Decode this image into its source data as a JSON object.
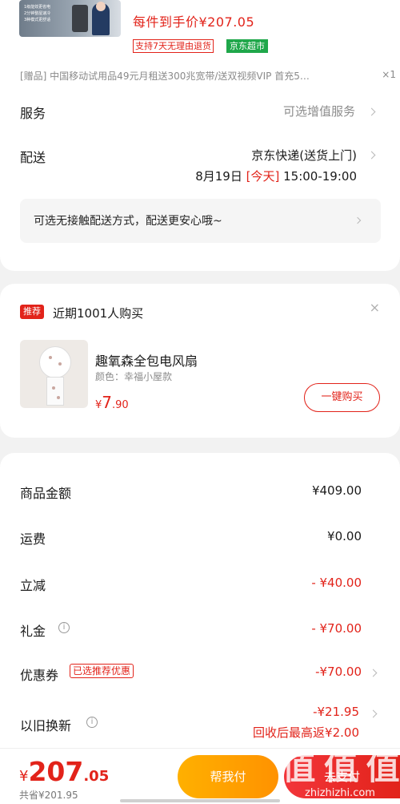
{
  "product": {
    "thumb_lines": [
      "1级能效更省电",
      "2分钟整屋速冷",
      "3种模式更舒适"
    ],
    "final_price_text": "每件到手价¥207.05",
    "return_badge": "支持7天无理由退货",
    "market_badge": "京东超市",
    "gift_text": "[赠品]   中国移动试用品49元月租送300兆宽带/送双视频VIP 首充5…",
    "gift_qty": "×1"
  },
  "service": {
    "label": "服务",
    "value": "可选增值服务"
  },
  "delivery": {
    "label": "配送",
    "carrier": "京东快递(送货上门)",
    "date": "8月19日",
    "today_tag": "[今天]",
    "time": "15:00-19:00",
    "no_contact": "可选无接触配送方式，配送更安心哦~"
  },
  "recommend": {
    "tag": "推荐",
    "title": "近期1001人购买",
    "close": "×",
    "name": "趣氧森全包电风扇",
    "color": "颜色：幸福小屋款",
    "price_symbol": "¥",
    "price_int": "7",
    "price_dec": ".90",
    "buy_label": "一键购买"
  },
  "summary": {
    "goods_label": "商品金额",
    "goods_value": "¥409.00",
    "freight_label": "运费",
    "freight_value": "¥0.00",
    "discount_label": "立减",
    "discount_value": "- ¥40.00",
    "gift_money_label": "礼金",
    "gift_money_value": "- ¥70.00",
    "coupon_label": "优惠券",
    "coupon_tag": "已选推荐优惠",
    "coupon_value": "-¥70.00",
    "tradein_label": "以旧换新",
    "tradein_value": "-¥21.95",
    "tradein_note": "回收后最高返¥2.00",
    "info_glyph": "i"
  },
  "footer": {
    "total_symbol": "¥",
    "total_int": "207",
    "total_dec": ".05",
    "saved": "共省¥201.95",
    "help_pay": "帮我付",
    "pay": "去支付",
    "watermark": "值 值 值",
    "watermark_url": "zhizhizhi.com"
  },
  "colors": {
    "accent": "#e2231a",
    "market_green": "#1fa74a",
    "help_orange": "#ffa200"
  }
}
